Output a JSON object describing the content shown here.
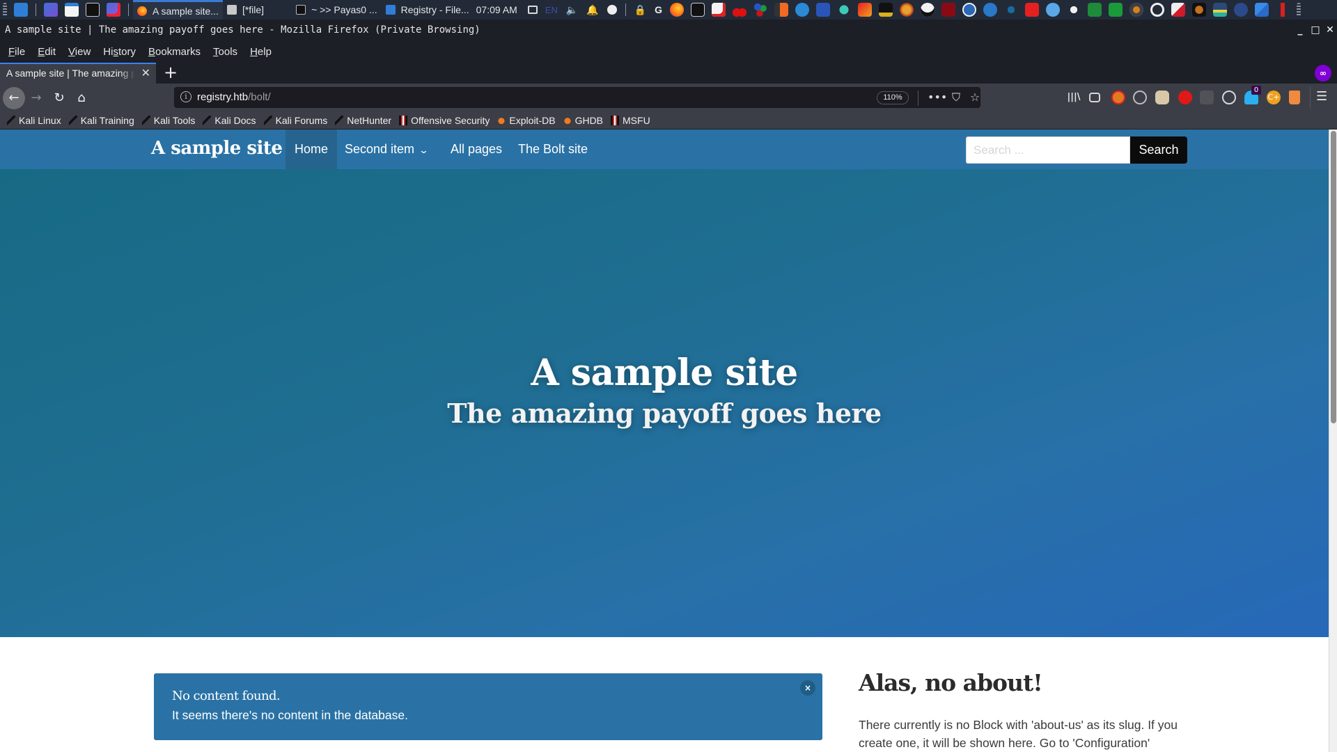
{
  "taskbar": {
    "tasks": [
      {
        "label": "A sample site...",
        "icon": "firefox-icon",
        "active": true
      },
      {
        "label": "[*file]",
        "icon": "text-editor-icon",
        "active": false
      },
      {
        "label": "~ >> Payas0 ...",
        "icon": "terminal-icon",
        "active": false
      },
      {
        "label": "Registry - File...",
        "icon": "folder-icon",
        "active": false
      }
    ],
    "clock": "07:09 AM",
    "keyboard_layout": "EN"
  },
  "window": {
    "title": "A sample site | The amazing payoff goes here - Mozilla Firefox (Private Browsing)"
  },
  "menu": {
    "items": [
      {
        "label": "File",
        "accel": "F"
      },
      {
        "label": "Edit",
        "accel": "E"
      },
      {
        "label": "View",
        "accel": "V"
      },
      {
        "label": "History",
        "accel": "s"
      },
      {
        "label": "Bookmarks",
        "accel": "B"
      },
      {
        "label": "Tools",
        "accel": "T"
      },
      {
        "label": "Help",
        "accel": "H"
      }
    ]
  },
  "tabs": {
    "active_title": "A sample site | The amazing payoff goes here",
    "close_glyph": "✕",
    "new_tab_glyph": "+"
  },
  "toolbar": {
    "url_host": "registry.htb",
    "url_path": "/bolt/",
    "zoom": "110%",
    "extension_badge_count": "0"
  },
  "bookmarks": [
    {
      "label": "Kali Linux",
      "icon": "kali-dragon-icon"
    },
    {
      "label": "Kali Training",
      "icon": "kali-dragon-icon"
    },
    {
      "label": "Kali Tools",
      "icon": "kali-dragon-icon"
    },
    {
      "label": "Kali Docs",
      "icon": "kali-dragon-icon"
    },
    {
      "label": "Kali Forums",
      "icon": "kali-dragon-icon"
    },
    {
      "label": "NetHunter",
      "icon": "kali-dragon-icon"
    },
    {
      "label": "Offensive Security",
      "icon": "offsec-icon"
    },
    {
      "label": "Exploit-DB",
      "icon": "exploit-db-icon"
    },
    {
      "label": "GHDB",
      "icon": "exploit-db-icon"
    },
    {
      "label": "MSFU",
      "icon": "offsec-icon"
    }
  ],
  "site": {
    "brand": "A sample site",
    "nav": [
      {
        "label": "Home",
        "active": true
      },
      {
        "label": "Second item",
        "has_dropdown": true
      },
      {
        "label": "All pages"
      },
      {
        "label": "The Bolt site"
      }
    ],
    "search": {
      "placeholder": "Search ...",
      "value": "",
      "button": "Search"
    },
    "hero": {
      "title": "A sample site",
      "subtitle": "The amazing payoff goes here"
    },
    "alert": {
      "title": "No content found.",
      "text": "It seems there's no content in the database.",
      "close": "×"
    },
    "about": {
      "heading": "Alas, no about!",
      "text": "There currently is no Block with 'about-us' as its slug. If you create one, it will be shown here. Go to 'Configuration'"
    }
  },
  "colors": {
    "site_primary": "#2a72a5",
    "hero_gradient_start": "#176a84",
    "hero_gradient_end": "#2768b8",
    "private_browsing": "#8000d7",
    "tab_accent": "#3a82f5"
  }
}
